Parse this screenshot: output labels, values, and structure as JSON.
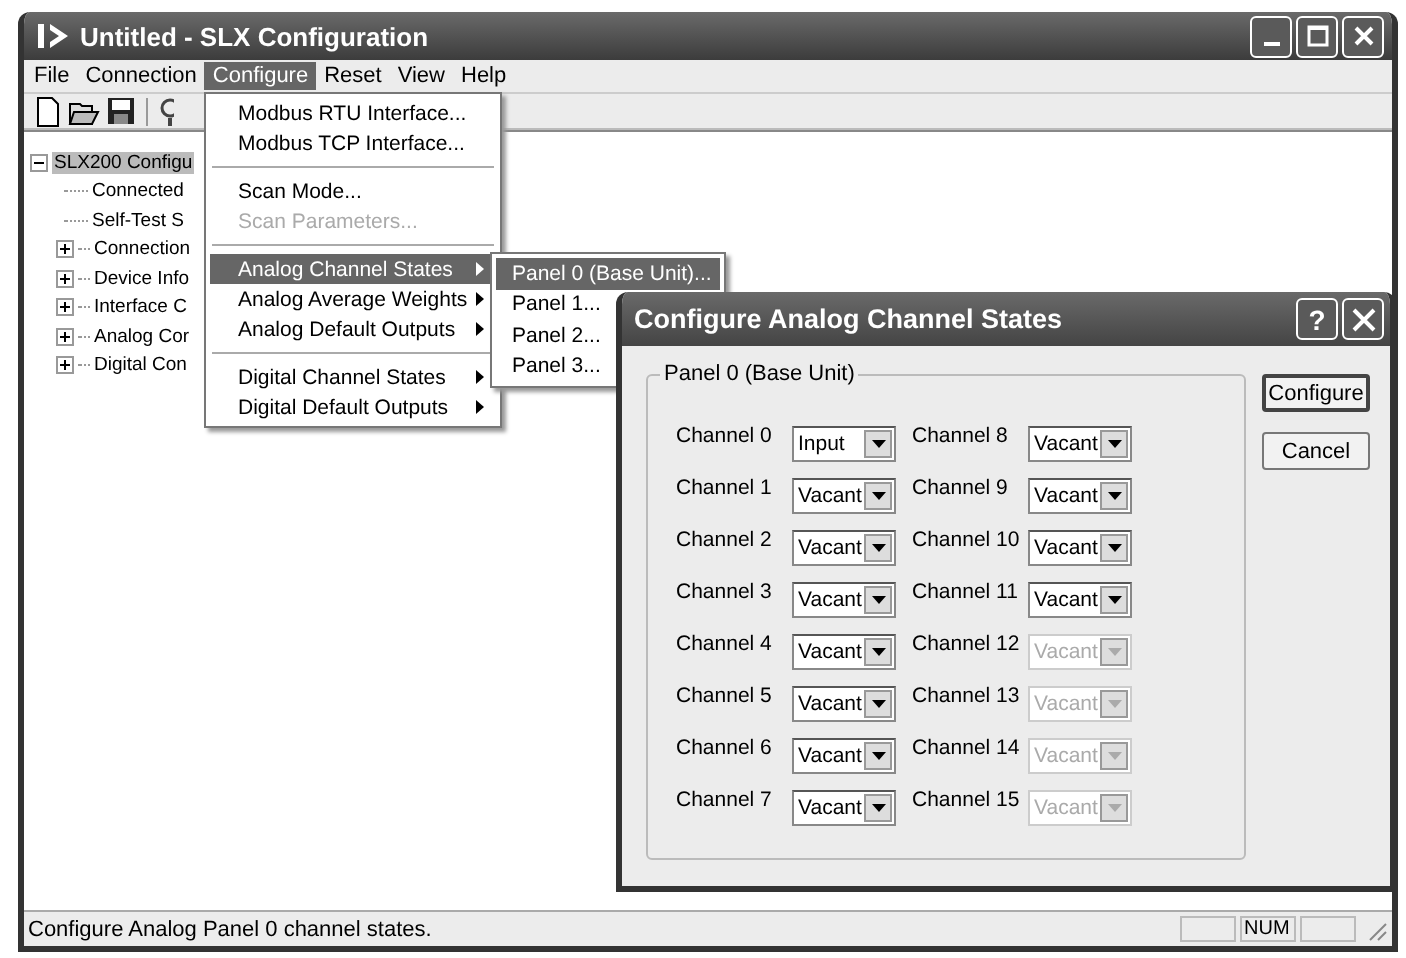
{
  "window": {
    "title": "Untitled - SLX Configuration"
  },
  "menu_bar": [
    {
      "label": "File",
      "selected": false
    },
    {
      "label": "Connection",
      "selected": false
    },
    {
      "label": "Configure",
      "selected": true
    },
    {
      "label": "Reset",
      "selected": false
    },
    {
      "label": "View",
      "selected": false
    },
    {
      "label": "Help",
      "selected": false
    }
  ],
  "tree": {
    "label": "SLX200 Configu",
    "expanded": true,
    "selected": true,
    "children": [
      {
        "label": "Connected",
        "kind": "leaf",
        "selected": false
      },
      {
        "label": "Self-Test S",
        "kind": "leaf",
        "selected": false
      },
      {
        "label": "Connection",
        "kind": "collapsed",
        "selected": false
      },
      {
        "label": "Device Info",
        "kind": "collapsed",
        "selected": false
      },
      {
        "label": "Interface C",
        "kind": "collapsed",
        "selected": false
      },
      {
        "label": "Analog Cor",
        "kind": "collapsed",
        "selected": false
      },
      {
        "label": "Digital Con",
        "kind": "collapsed",
        "selected": false
      }
    ]
  },
  "configure_menu": [
    {
      "kind": "item",
      "label": "Modbus RTU Interface...",
      "disabled": false,
      "selected": false
    },
    {
      "kind": "item",
      "label": "Modbus TCP Interface...",
      "disabled": false,
      "selected": false
    },
    {
      "kind": "separator"
    },
    {
      "kind": "item",
      "label": "Scan Mode...",
      "disabled": false,
      "selected": false
    },
    {
      "kind": "item",
      "label": "Scan Parameters...",
      "disabled": true,
      "selected": false
    },
    {
      "kind": "separator"
    },
    {
      "kind": "submenu",
      "label": "Analog Channel States",
      "disabled": false,
      "selected": true
    },
    {
      "kind": "submenu",
      "label": "Analog Average Weights",
      "disabled": false,
      "selected": false
    },
    {
      "kind": "submenu",
      "label": "Analog Default Outputs",
      "disabled": false,
      "selected": false
    },
    {
      "kind": "separator"
    },
    {
      "kind": "submenu",
      "label": "Digital Channel States",
      "disabled": false,
      "selected": false
    },
    {
      "kind": "submenu",
      "label": "Digital Default Outputs",
      "disabled": false,
      "selected": false
    }
  ],
  "submenu": [
    {
      "label": "Panel 0 (Base Unit)...",
      "selected": true
    },
    {
      "label": "Panel 1...",
      "selected": false
    },
    {
      "label": "Panel 2...",
      "selected": false
    },
    {
      "label": "Panel 3...",
      "selected": false
    }
  ],
  "dialog": {
    "title": "Configure Analog Channel States",
    "help_button": "?",
    "group_label": "Panel 0 (Base Unit)",
    "channels": [
      {
        "label": "Channel 0",
        "value": "Input",
        "disabled": false
      },
      {
        "label": "Channel 1",
        "value": "Vacant",
        "disabled": false
      },
      {
        "label": "Channel 2",
        "value": "Vacant",
        "disabled": false
      },
      {
        "label": "Channel 3",
        "value": "Vacant",
        "disabled": false
      },
      {
        "label": "Channel 4",
        "value": "Vacant",
        "disabled": false
      },
      {
        "label": "Channel 5",
        "value": "Vacant",
        "disabled": false
      },
      {
        "label": "Channel 6",
        "value": "Vacant",
        "disabled": false
      },
      {
        "label": "Channel 7",
        "value": "Vacant",
        "disabled": false
      },
      {
        "label": "Channel 8",
        "value": "Vacant",
        "disabled": false
      },
      {
        "label": "Channel 9",
        "value": "Vacant",
        "disabled": false
      },
      {
        "label": "Channel 10",
        "value": "Vacant",
        "disabled": false
      },
      {
        "label": "Channel 11",
        "value": "Vacant",
        "disabled": false
      },
      {
        "label": "Channel 12",
        "value": "Vacant",
        "disabled": true
      },
      {
        "label": "Channel 13",
        "value": "Vacant",
        "disabled": true
      },
      {
        "label": "Channel 14",
        "value": "Vacant",
        "disabled": true
      },
      {
        "label": "Channel 15",
        "value": "Vacant",
        "disabled": true
      }
    ],
    "buttons": [
      {
        "label": "Configure",
        "default": true
      },
      {
        "label": "Cancel",
        "default": false
      }
    ]
  },
  "status_bar": {
    "text": "Configure Analog Panel 0 channel states.",
    "indicator": "NUM"
  }
}
